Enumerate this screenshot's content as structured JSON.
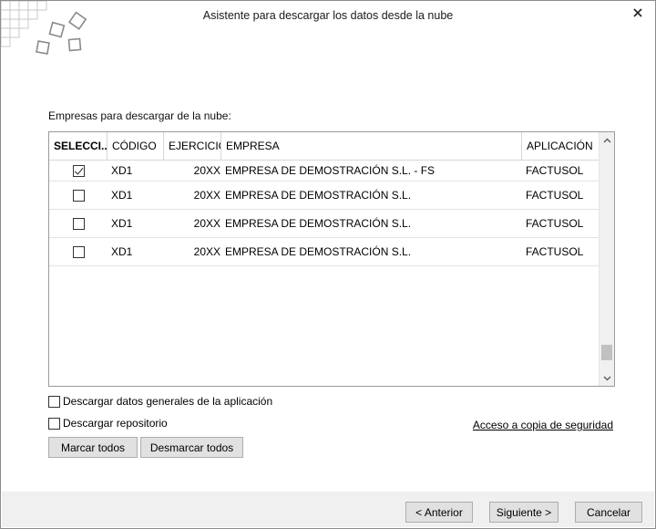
{
  "window": {
    "title": "Asistente para descargar los datos desde la nube"
  },
  "section": {
    "label": "Empresas para descargar de la nube:"
  },
  "grid": {
    "columns": [
      "SELECCI...",
      "CÓDIGO",
      "EJERCICIO",
      "EMPRESA",
      "APLICACIÓN"
    ],
    "rows": [
      {
        "checked": true,
        "codigo": "XD1",
        "ejercicio": "20XX",
        "empresa": "EMPRESA DE DEMOSTRACIÓN S.L. - FS",
        "aplicacion": "FACTUSOL"
      },
      {
        "checked": false,
        "codigo": "XD1",
        "ejercicio": "20XX",
        "empresa": "EMPRESA DE DEMOSTRACIÓN S.L.",
        "aplicacion": "FACTUSOL"
      },
      {
        "checked": false,
        "codigo": "XD1",
        "ejercicio": "20XX",
        "empresa": "EMPRESA DE DEMOSTRACIÓN S.L.",
        "aplicacion": "FACTUSOL"
      },
      {
        "checked": false,
        "codigo": "XD1",
        "ejercicio": "20XX",
        "empresa": "EMPRESA DE DEMOSTRACIÓN S.L.",
        "aplicacion": "FACTUSOL"
      }
    ]
  },
  "options": {
    "datos_generales": {
      "label": "Descargar datos generales de la aplicación",
      "checked": false
    },
    "repositorio": {
      "label": "Descargar repositorio",
      "checked": false
    }
  },
  "link": {
    "label": "Acceso a copia de seguridad"
  },
  "buttons": {
    "marcar_todos": "Marcar todos",
    "desmarcar_todos": "Desmarcar todos",
    "anterior": "< Anterior",
    "siguiente": "Siguiente >",
    "cancelar": "Cancelar"
  }
}
